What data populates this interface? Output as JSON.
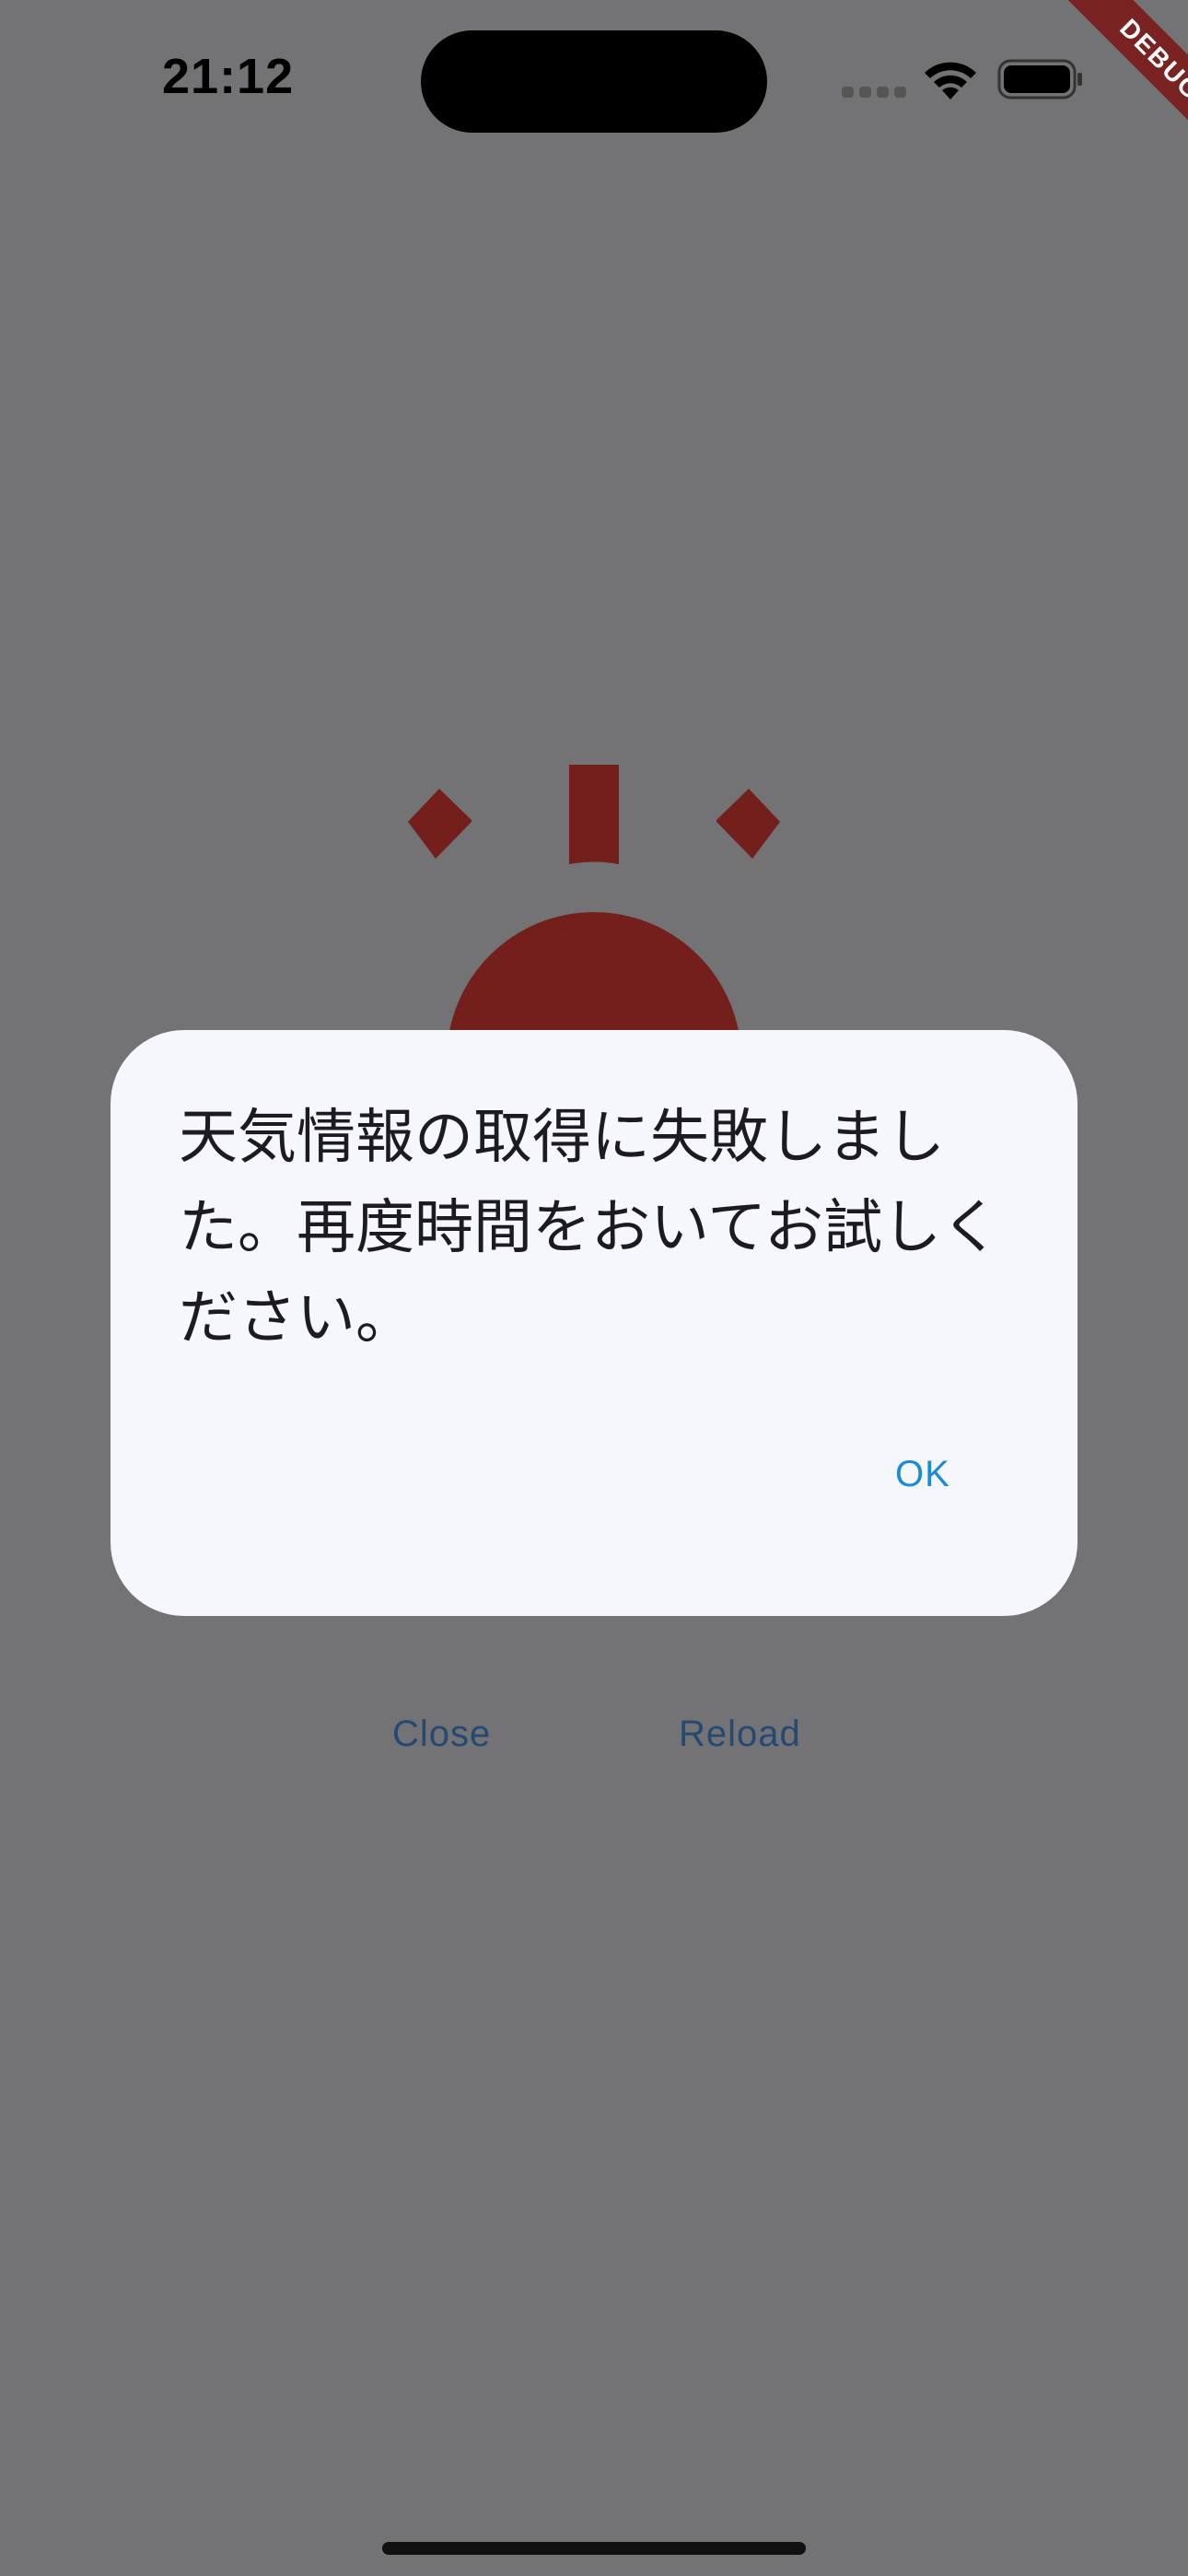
{
  "status_bar": {
    "time": "21:12",
    "icons": [
      "cellular-signal-icon",
      "wifi-icon",
      "battery-icon"
    ]
  },
  "debug_banner": {
    "label": "DEBUG",
    "color": "#7a2323"
  },
  "weather_icon": {
    "name": "sun-icon",
    "color": "#73201c"
  },
  "actions": {
    "close_label": "Close",
    "reload_label": "Reload"
  },
  "dialog": {
    "message": "天気情報の取得に失敗しました。再度時間をおいてお試しください。",
    "ok_label": "OK"
  },
  "colors": {
    "overlay": "#737375",
    "dialog_background": "#f6f7fc",
    "accent": "#1a8bd9"
  }
}
